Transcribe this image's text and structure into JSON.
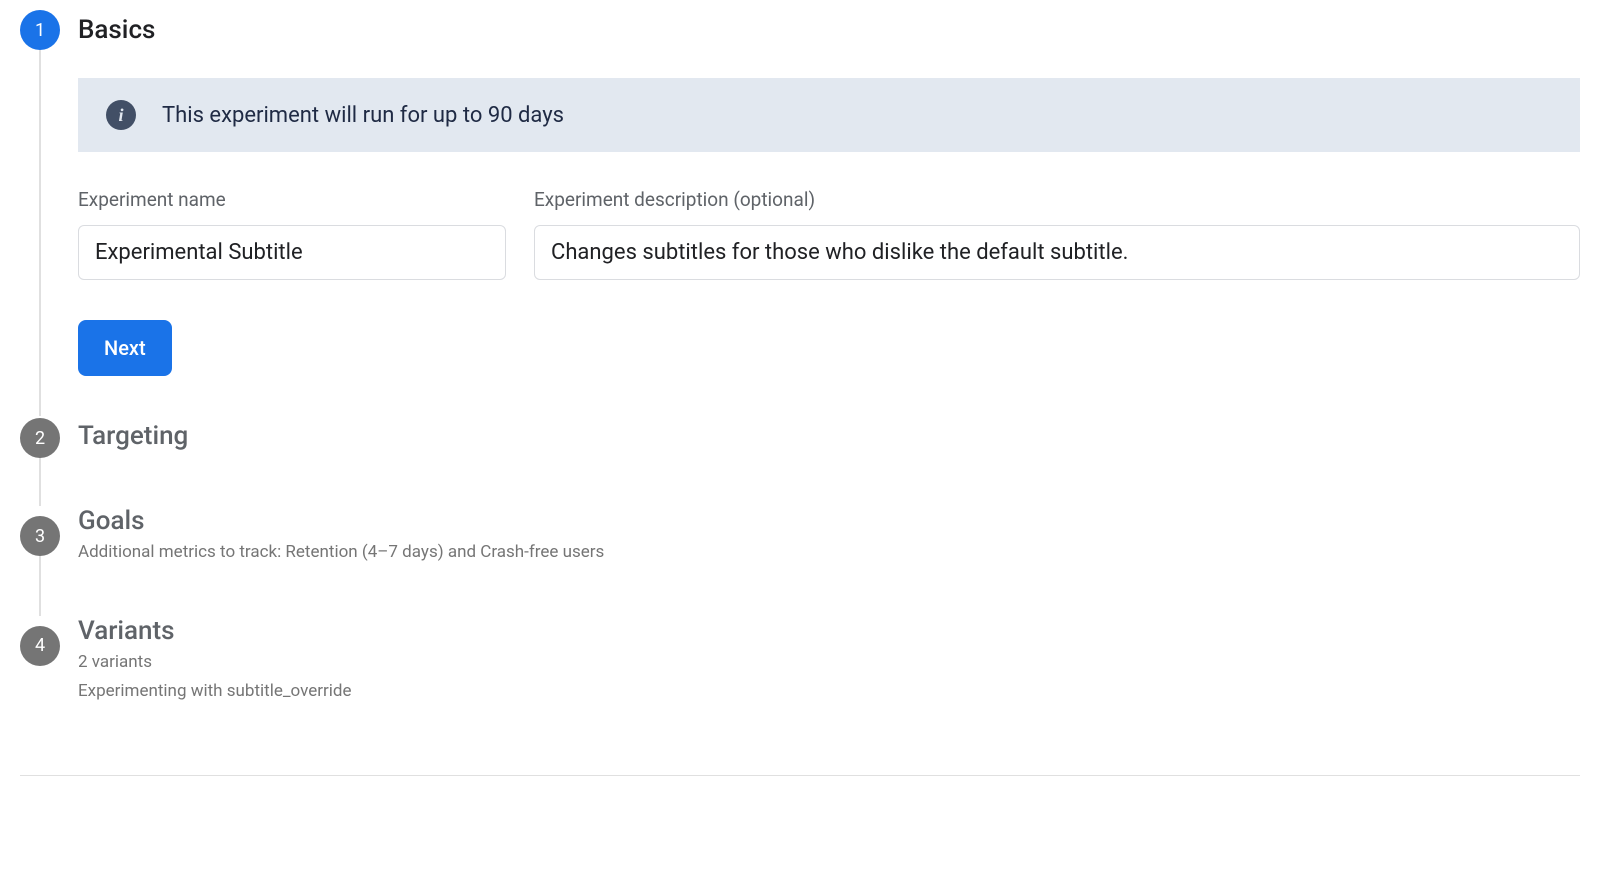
{
  "steps": {
    "basics": {
      "number": "1",
      "title": "Basics",
      "banner_text": "This experiment will run for up to 90 days",
      "name_label": "Experiment name",
      "name_value": "Experimental Subtitle",
      "desc_label": "Experiment description (optional)",
      "desc_value": "Changes subtitles for those who dislike the default subtitle.",
      "next_label": "Next"
    },
    "targeting": {
      "number": "2",
      "title": "Targeting"
    },
    "goals": {
      "number": "3",
      "title": "Goals",
      "subtitle": "Additional metrics to track: Retention (4–7 days) and Crash-free users"
    },
    "variants": {
      "number": "4",
      "title": "Variants",
      "subtitle1": "2 variants",
      "subtitle2": "Experimenting with subtitle_override"
    }
  }
}
